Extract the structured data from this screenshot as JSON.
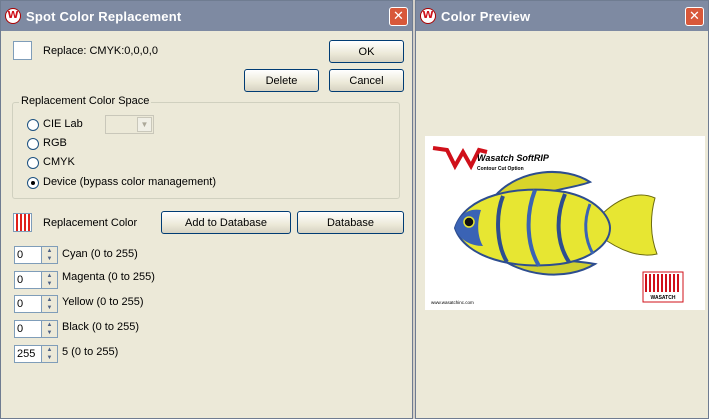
{
  "spot_window": {
    "title": "Spot Color Replacement",
    "close_glyph": "✕",
    "replace_label": "Replace: CMYK:0,0,0,0",
    "ok_label": "OK",
    "delete_label": "Delete",
    "cancel_label": "Cancel",
    "space_group": {
      "legend": "Replacement Color Space",
      "options": [
        {
          "label": "CIE Lab",
          "selected": false
        },
        {
          "label": "RGB",
          "selected": false
        },
        {
          "label": "CMYK",
          "selected": false
        },
        {
          "label": "Device (bypass color management)",
          "selected": true
        }
      ]
    },
    "replacement_color_label": "Replacement Color",
    "add_to_database_label": "Add to Database",
    "database_label": "Database",
    "channels": [
      {
        "value": "0",
        "label": "Cyan  (0 to 255)"
      },
      {
        "value": "0",
        "label": "Magenta  (0 to 255)"
      },
      {
        "value": "0",
        "label": "Yellow  (0 to 255)"
      },
      {
        "value": "0",
        "label": "Black  (0 to 255)"
      },
      {
        "value": "255",
        "label": "5  (0 to 255)"
      }
    ]
  },
  "preview_window": {
    "title": "Color Preview",
    "close_glyph": "✕",
    "brand_text": "Wasatch SoftRIP",
    "brand_sub": "Contour Cut Option",
    "footer_url": "www.wasatchinc.com",
    "badge_text": "WASATCH"
  },
  "colors": {
    "title_bar": "#7e8aa2",
    "close_button": "#d8583a",
    "accent_red": "#d0101a",
    "fish_yellow": "#e7e632",
    "fish_blue": "#2d4d8f"
  },
  "app_icon_glyph": "W"
}
